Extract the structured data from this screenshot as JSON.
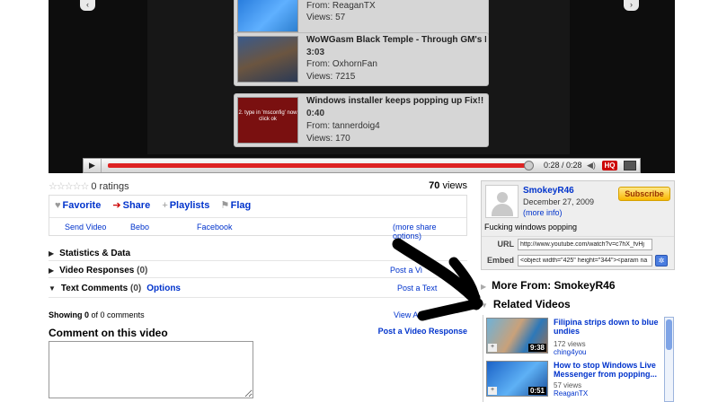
{
  "player": {
    "nav_left_icon": "chevron-left-icon",
    "nav_right_icon": "chevron-right-icon",
    "related": [
      {
        "title": "",
        "from_label": "From:",
        "from": "ReaganTX",
        "views_label": "Views:",
        "views": "57"
      },
      {
        "title": "WoWGasm Black Temple - Through GM's E",
        "duration": "3:03",
        "from_label": "From:",
        "from": "OxhornFan",
        "views_label": "Views:",
        "views": "7215"
      },
      {
        "title": "Windows installer keeps popping up Fix!!",
        "duration": "0:40",
        "from_label": "From:",
        "from": "tannerdoig4",
        "views_label": "Views:",
        "views": "170",
        "thumb_text": "2. type in 'msconfig' now click ok"
      }
    ],
    "controls": {
      "time": "0:28 / 0:28",
      "hq_label": "HQ",
      "progress": 1.0
    }
  },
  "info": {
    "stars": "☆☆☆☆☆",
    "ratings": "0 ratings",
    "views_number": "70",
    "views_label": "views",
    "actions": {
      "favorite": "Favorite",
      "share": "Share",
      "playlists": "Playlists",
      "flag": "Flag"
    },
    "share_links": {
      "send_video": "Send Video",
      "bebo": "Bebo",
      "facebook": "Facebook",
      "more": "(more share options)"
    },
    "sections": {
      "statistics": "Statistics & Data",
      "video_responses": "Video Responses",
      "video_responses_count": "(0)",
      "text_comments": "Text Comments",
      "text_comments_count": "(0)",
      "options": "Options",
      "post_video_response_short": "Post a Vi",
      "post_text_short": "Post a Text",
      "view_all_short": "View All"
    },
    "showing_prefix": "Showing",
    "showing_bold": "0",
    "showing_suffix": "of 0 comments",
    "comment_heading": "Comment on this video",
    "post_video_response": "Post a Video Response"
  },
  "channel": {
    "username": "SmokeyR46",
    "date": "December 27, 2009",
    "more_info": "(more info)",
    "subscribe": "Subscribe",
    "description": "Fucking windows popping",
    "url_label": "URL",
    "url_value": "http://www.youtube.com/watch?v=c7hX_fvHj",
    "embed_label": "Embed",
    "embed_value": "<object width=\"425\" height=\"344\"><param na"
  },
  "right": {
    "more_from": "More From: SmokeyR46",
    "related_heading": "Related Videos",
    "related": [
      {
        "title": "Filipina strips down to blue undies",
        "views": "172 views",
        "user": "ching4you",
        "duration": "9:38"
      },
      {
        "title": "How to stop Windows Live Messenger from popping...",
        "views": "57 views",
        "user": "ReaganTX",
        "duration": "0:51"
      }
    ]
  }
}
